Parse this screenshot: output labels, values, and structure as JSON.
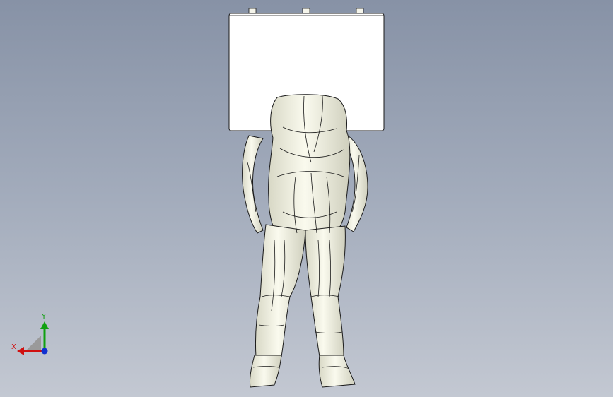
{
  "viewport": {
    "background_top": "#8792a6",
    "background_bottom": "#c3c8d2"
  },
  "model": {
    "description_icon": "human-figure-with-sign-model",
    "body_fill": "#f2f2e4",
    "sign_fill": "#ffffff",
    "edge_color": "#1a1a1a"
  },
  "triad": {
    "x_label": "X",
    "y_label": "Y",
    "x_color": "#d01010",
    "y_color": "#10a010",
    "z_color": "#1030d0"
  }
}
